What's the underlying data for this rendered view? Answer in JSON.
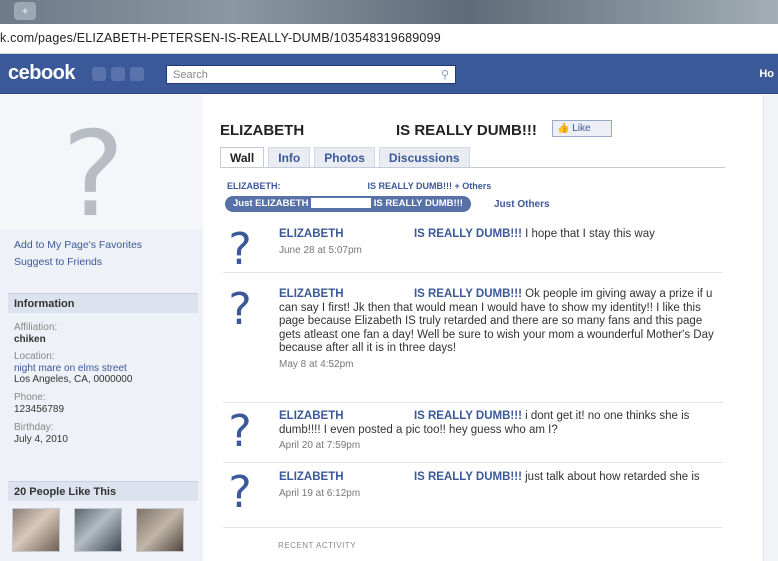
{
  "browser": {
    "url": "k.com/pages/ELIZABETH-PETERSEN-IS-REALLY-DUMB/103548319689099",
    "tab_button": "+"
  },
  "header": {
    "logo": "cebook",
    "search_placeholder": "Search",
    "search_icon": "magnifier-icon",
    "home_label": "Ho"
  },
  "sidebar": {
    "links": [
      "Add to My Page's Favorites",
      "Suggest to Friends"
    ],
    "info_heading": "Information",
    "info": [
      {
        "label": "Affiliation:",
        "value": "chiken"
      },
      {
        "label": "Location:",
        "link": "night mare on elms street",
        "value": "Los Angeles, CA, 0000000"
      },
      {
        "label": "Phone:",
        "value": "123456789"
      },
      {
        "label": "Birthday:",
        "value": "July 4, 2010"
      }
    ],
    "likes_heading": "20 People Like This"
  },
  "page": {
    "title_first": "ELIZABETH",
    "title_rest": "IS REALLY DUMB!!!",
    "like_button": "Like",
    "tabs": [
      "Wall",
      "Info",
      "Photos",
      "Discussions"
    ],
    "filter_line_a": "ELIZABETH:",
    "filter_line_b": "IS REALLY DUMB!!! + Others",
    "filter_pill_a": "Just ELIZABETH",
    "filter_pill_b": "IS REALLY DUMB!!!",
    "filter_others": "Just Others",
    "recent_activity": "RECENT ACTIVITY"
  },
  "posts": [
    {
      "name_a": "ELIZABETH",
      "name_b": "IS REALLY DUMB!!!",
      "text": "I hope that I stay this way",
      "time": "June 28 at 5:07pm"
    },
    {
      "name_a": "ELIZABETH",
      "name_b": "IS REALLY DUMB!!!",
      "text": "Ok people im giving away a prize if u can say I first! Jk then that would mean I would have to show my identity!! I like this page because Elizabeth IS truly retarded and there are so many fans and this page gets atleast one fan a day! Well be sure to wish your mom a wounderful Mother's Day because after all it is in three days!",
      "time": "May 8 at 4:52pm"
    },
    {
      "name_a": "ELIZABETH",
      "name_b": "IS REALLY DUMB!!!",
      "text": "i dont get it! no one thinks she is dumb!!!! I even posted a pic too!! hey guess who am I?",
      "time": "April 20 at 7:59pm"
    },
    {
      "name_a": "ELIZABETH",
      "name_b": "IS REALLY DUMB!!!",
      "text": "just talk about how retarded she is",
      "time": "April 19 at 6:12pm"
    }
  ],
  "colors": {
    "brand": "#3b5998",
    "sidebar_bg": "#eef1f7"
  }
}
